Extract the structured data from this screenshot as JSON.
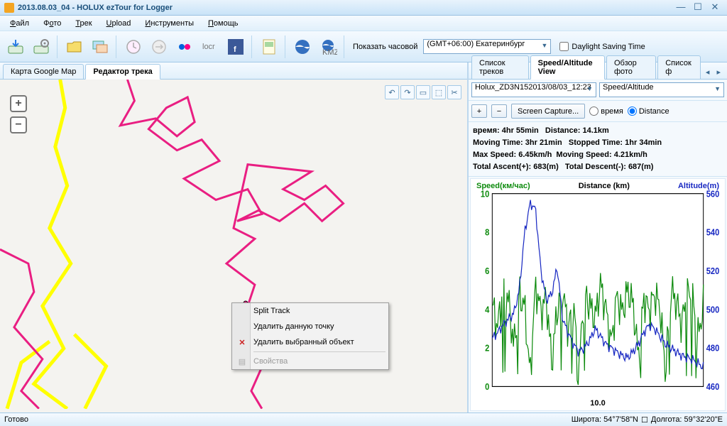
{
  "window": {
    "title": "2013.08.03_04 - HOLUX ezTour for Logger"
  },
  "menu": {
    "file": "Файл",
    "photo": "Фото",
    "track": "Трек",
    "upload": "Upload",
    "tools": "Инструменты",
    "help": "Помощь"
  },
  "toolbar": {
    "show_timezone": "Показать часовой",
    "timezone_value": "(GMT+06:00) Екатеринбург",
    "dst": "Daylight Saving Time"
  },
  "left_tabs": {
    "google_map": "Карта Google Map",
    "track_editor": "Редактор трека"
  },
  "context_menu": {
    "split": "Split Track",
    "delete_point": "Удалить данную точку",
    "delete_object": "Удалить выбранный объект",
    "properties": "Свойства"
  },
  "right_tabs": {
    "track_list": "Список треков",
    "speed_alt": "Speed/Altitude View",
    "photo_overview": "Обзор фото",
    "photo_list": "Список ф"
  },
  "controls": {
    "track_select": "Holux_ZD3N152013/08/03_12:23",
    "view_select": "Speed/Altitude",
    "screen_capture": "Screen Capture...",
    "time_radio": "время",
    "distance_radio": "Distance"
  },
  "stats": {
    "time_label": "время:",
    "time_val": "4hr 55min",
    "dist_label": "Distance:",
    "dist_val": "14.1km",
    "moving_label": "Moving Time:",
    "moving_val": "3hr 21min",
    "stopped_label": "Stopped Time:",
    "stopped_val": "1hr 34min",
    "maxspeed_label": "Max Speed:",
    "maxspeed_val": "6.45km/h",
    "movspeed_label": "Moving Speed:",
    "movspeed_val": "4.21km/h",
    "ascent_label": "Total Ascent(+):",
    "ascent_val": "683(m)",
    "descent_label": "Total Descent(-):",
    "descent_val": "687(m)"
  },
  "chart": {
    "speed_label": "Speed(км/час)",
    "dist_label": "Distance (km)",
    "alt_label": "Altitude(m)",
    "speed_ticks": [
      0,
      2,
      4,
      6,
      8,
      10
    ],
    "alt_ticks": [
      460,
      480,
      500,
      520,
      540,
      560
    ],
    "x_center": "10.0"
  },
  "chart_data": {
    "type": "line",
    "xlabel": "Distance (km)",
    "x_range": [
      0,
      14.1
    ],
    "series": [
      {
        "name": "Speed (km/h)",
        "color": "#0c8a0c",
        "ylim": [
          0,
          10
        ],
        "values": [
          4.2,
          3.1,
          5.0,
          4.5,
          2.0,
          4.8,
          4.1,
          0.5,
          5.2,
          3.9,
          4.6,
          1.2,
          4.0,
          5.1,
          3.0,
          4.4,
          0.8,
          4.9,
          4.2,
          3.5,
          5.3,
          4.0,
          2.2,
          4.7,
          3.8,
          5.0,
          4.3,
          1.5,
          4.6,
          3.9,
          4.8,
          4.1,
          0.7,
          5.0,
          4.4,
          3.2,
          4.9,
          4.5,
          2.5,
          4.2
        ]
      },
      {
        "name": "Altitude (m)",
        "color": "#1828c2",
        "ylim": [
          460,
          560
        ],
        "values": [
          485,
          488,
          492,
          495,
          498,
          510,
          540,
          555,
          552,
          520,
          505,
          508,
          522,
          495,
          488,
          482,
          478,
          480,
          484,
          490,
          486,
          482,
          480,
          478,
          476,
          475,
          478,
          482,
          488,
          492,
          490,
          486,
          482,
          480,
          478,
          476,
          475,
          474,
          472,
          470
        ]
      }
    ]
  },
  "status": {
    "ready": "Готово",
    "lat": "Широта: 54°7'58\"N",
    "lon": "Долгота: 59°32'20\"E"
  }
}
